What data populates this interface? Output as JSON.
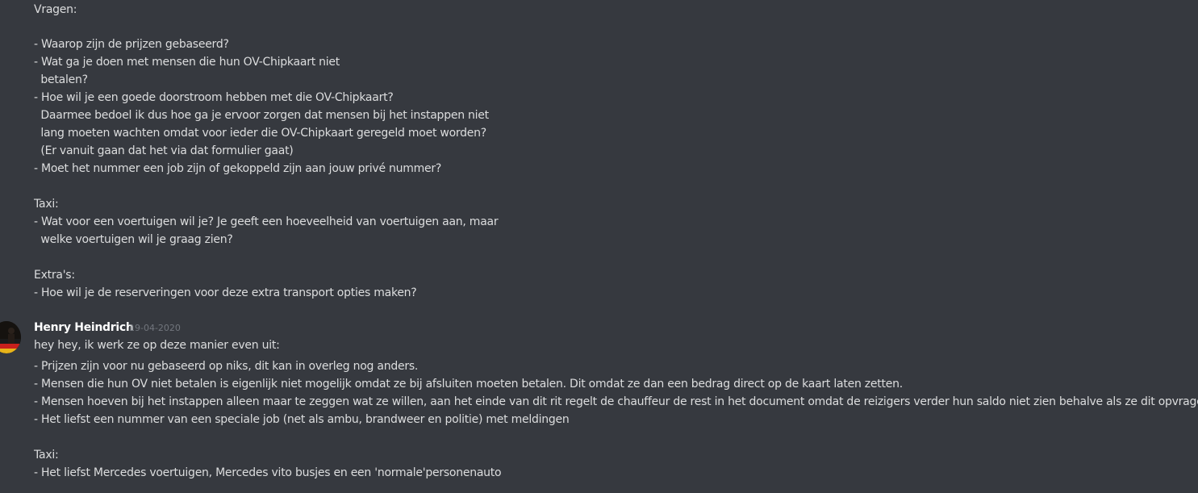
{
  "prev_message": {
    "lines": [
      "Vragen:",
      "- Waarop zijn de prijzen gebaseerd?",
      "- Wat ga je doen met mensen die hun OV-Chipkaart niet",
      "  betalen?",
      "- Hoe wil je een goede doorstroom hebben met die OV-Chipkaart?",
      "  Daarmee bedoel ik dus hoe ga je ervoor zorgen dat mensen bij het instappen niet",
      "  lang moeten wachten omdat voor ieder die OV-Chipkaart geregeld moet worden?",
      "  (Er vanuit gaan dat het via dat formulier gaat)",
      "- Moet het nummer een job zijn of gekoppeld zijn aan jouw privé nummer?",
      "Taxi:",
      "- Wat voor een voertuigen wil je? Je geeft een hoeveelheid van voertuigen aan, maar",
      "  welke voertuigen wil je graag zien?",
      "Extra's:",
      "- Hoe wil je de reserveringen voor deze extra transport opties maken?"
    ]
  },
  "message": {
    "author": "Henry Heindrich",
    "timestamp": "19-04-2020",
    "lines": [
      "hey hey, ik werk ze op deze manier even uit:",
      "- Prijzen zijn voor nu gebaseerd op niks, dit kan in overleg nog anders.",
      "- Mensen die hun OV niet betalen is eigenlijk niet mogelijk omdat ze bij afsluiten moeten betalen. Dit omdat ze dan een bedrag direct op de kaart laten zetten.",
      "- Mensen hoeven bij het instappen alleen maar te zeggen wat ze willen, aan het einde van dit rit regelt de chauffeur de rest in het document omdat de reizigers verder hun saldo niet zien behalve als ze dit opvragen.",
      "- Het liefst een nummer van een speciale job (net als ambu, brandweer en politie) met meldingen",
      "Taxi:",
      "- Het liefst Mercedes voertuigen, Mercedes vito busjes en een 'normale'personenauto"
    ]
  },
  "colors": {
    "background": "#36393f",
    "text": "#dcddde",
    "author": "#ffffff",
    "timestamp": "#72767d"
  }
}
